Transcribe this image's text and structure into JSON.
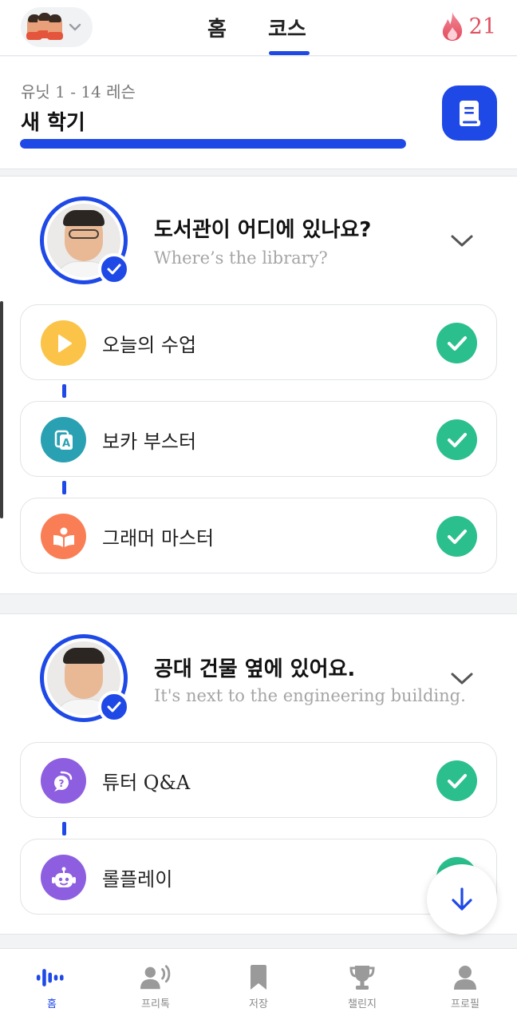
{
  "header": {
    "tabs": [
      {
        "label": "홈"
      },
      {
        "label": "코스"
      }
    ],
    "active_tab": "코스",
    "streak_count": "21",
    "icons": {
      "avatar": "group-avatar-icon",
      "chevron": "chevron-down-icon",
      "streak": "flame-icon"
    }
  },
  "unit": {
    "subtitle": "유닛 1 - 14 레슨",
    "title": "새 학기",
    "progress": 1.0,
    "book_button_icon": "book-icon"
  },
  "lessons": [
    {
      "title": "도서관이 어디에 있나요?",
      "subtitle": "Where’s the library?",
      "completed": true,
      "activities": [
        {
          "label": "오늘의 수업",
          "icon": "play-icon",
          "color": "#fbc449",
          "done": true
        },
        {
          "label": "보카 부스터",
          "icon": "vocab-card-icon",
          "color": "#2aa1b3",
          "done": true
        },
        {
          "label": "그래머 마스터",
          "icon": "open-book-icon",
          "color": "#fa7e55",
          "done": true
        }
      ]
    },
    {
      "title": "공대 건물 옆에 있어요.",
      "subtitle": "It's next to the engineering building.",
      "completed": true,
      "activities": [
        {
          "label": "튜터 Q&A",
          "icon": "question-bubble-icon",
          "color": "#8e5ee0",
          "done": true
        },
        {
          "label": "롤플레이",
          "icon": "robot-icon",
          "color": "#8e5ee0",
          "done": true
        }
      ]
    }
  ],
  "bottom_nav": [
    {
      "label": "홈",
      "icon": "voice-wave-icon",
      "active": true
    },
    {
      "label": "프리톡",
      "icon": "speaker-person-icon",
      "active": false
    },
    {
      "label": "저장",
      "icon": "bookmark-icon",
      "active": false
    },
    {
      "label": "챌린지",
      "icon": "trophy-icon",
      "active": false
    },
    {
      "label": "프로필",
      "icon": "person-icon",
      "active": false
    }
  ],
  "colors": {
    "accent": "#1f49e6",
    "success": "#2bbf8e",
    "streak": "#e0505e"
  }
}
